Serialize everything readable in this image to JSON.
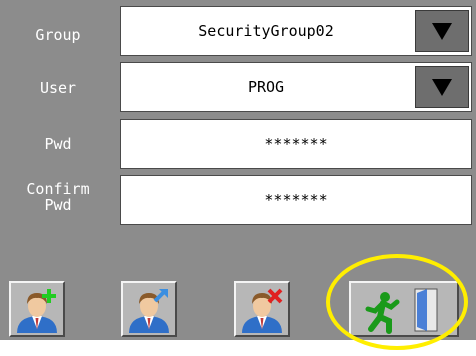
{
  "form": {
    "group": {
      "label": "Group",
      "value": "SecurityGroup02"
    },
    "user": {
      "label": "User",
      "value": "PROG"
    },
    "pwd": {
      "label": "Pwd",
      "value": "*******"
    },
    "confirm": {
      "label_line1": "Confirm",
      "label_line2": "Pwd",
      "value": "*******"
    }
  },
  "toolbar": {
    "buttons": [
      {
        "name": "add-user",
        "icon": "user-add-icon"
      },
      {
        "name": "edit-user",
        "icon": "user-edit-icon"
      },
      {
        "name": "delete-user",
        "icon": "user-delete-icon"
      },
      {
        "name": "exit",
        "icon": "exit-door-icon"
      }
    ]
  },
  "colors": {
    "panel_bg": "#8c8c8c",
    "highlight": "#ffee00",
    "add": "#22cc22",
    "edit": "#3a8ee0",
    "delete": "#e02020",
    "exit_figure": "#1a9a1a",
    "door": "#4a7fd6"
  }
}
